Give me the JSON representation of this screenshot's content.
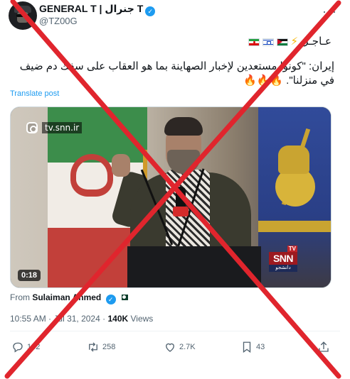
{
  "author": {
    "display_name": "GENERAL T | جنرال T",
    "handle": "@TZ00G",
    "verified_mark": "✓"
  },
  "more_menu": "···",
  "breaking": {
    "text": "عـاجـل",
    "bolt": "⚡",
    "flags": [
      "iran-flag-icon",
      "israel-flag-icon",
      "jordan-flag-icon"
    ]
  },
  "tweet": {
    "text": "إيران: \"كونوا مستعدين لإخبار الصهاينة بما هو العقاب على سفك دم ضيف في منزلنا\". 🔥🔥🔥",
    "translate_label": "Translate post"
  },
  "media": {
    "watermark": "tv.snn.ir",
    "duration": "0:18",
    "channel_logo": {
      "tv": "TV",
      "name": "SNN",
      "sub": "دانشجو"
    }
  },
  "attribution": {
    "prefix": "From",
    "name": "Sulaiman Ahmed"
  },
  "meta": {
    "time": "10:55 AM",
    "date": "Jul 31, 2024",
    "separator": "·",
    "views_count": "140K",
    "views_label": "Views"
  },
  "actions": {
    "replies": "132",
    "reposts": "258",
    "likes": "2.7K",
    "bookmarks": "43"
  },
  "colors": {
    "accent": "#1d9bf0",
    "cross": "#e0252d",
    "muted": "#536471"
  }
}
